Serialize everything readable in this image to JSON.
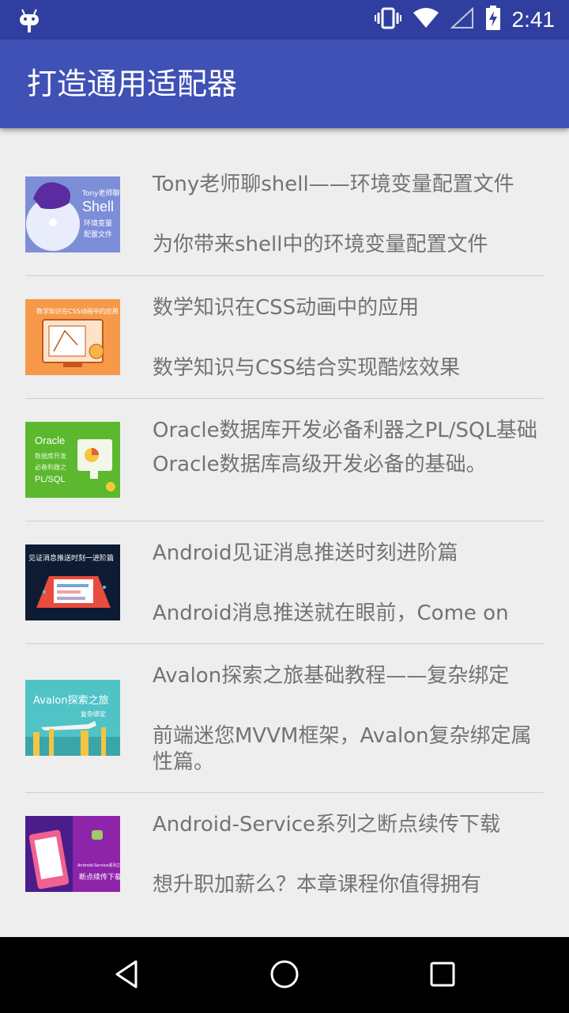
{
  "status_bar": {
    "time": "2:41",
    "icons": [
      "android-icon",
      "vibrate-icon",
      "wifi-icon",
      "signal-icon",
      "battery-charging-icon"
    ]
  },
  "app_bar": {
    "title": "打造通用适配器"
  },
  "items": [
    {
      "title": "Tony老师聊shell——环境变量配置文件",
      "desc": "为你带来shell中的环境变量配置文件",
      "thumb_text": "Tony老师聊 Shell 环境变量配置文件"
    },
    {
      "title": "数学知识在CSS动画中的应用",
      "desc": "数学知识与CSS结合实现酷炫效果",
      "thumb_text": "数学知识在CSS动画中的应用"
    },
    {
      "title": "Oracle数据库开发必备利器之PL/SQL基础",
      "desc": "Oracle数据库高级开发必备的基础。",
      "thumb_text": "Oracle 数据库开发 必备利器之 PL/SQL"
    },
    {
      "title": "Android见证消息推送时刻进阶篇",
      "desc": "Android消息推送就在眼前，Come on",
      "thumb_text": "见证消息推送时刻一进阶篇"
    },
    {
      "title": "Avalon探索之旅基础教程——复杂绑定",
      "desc": "前端迷您MVVM框架，Avalon复杂绑定属性篇。",
      "thumb_text": "Avalon探索之旅 复杂绑定"
    },
    {
      "title": "Android-Service系列之断点续传下载",
      "desc": "想升职加薪么？本章课程你值得拥有",
      "thumb_text": "断点续传下载"
    }
  ],
  "colors": {
    "status_bar": "#303f9f",
    "app_bar": "#3f51b5",
    "background": "#eeeeee",
    "text": "#737373",
    "divider": "#cfcfcf"
  },
  "nav_bar": {
    "buttons": [
      "back-icon",
      "home-icon",
      "recents-icon"
    ]
  }
}
